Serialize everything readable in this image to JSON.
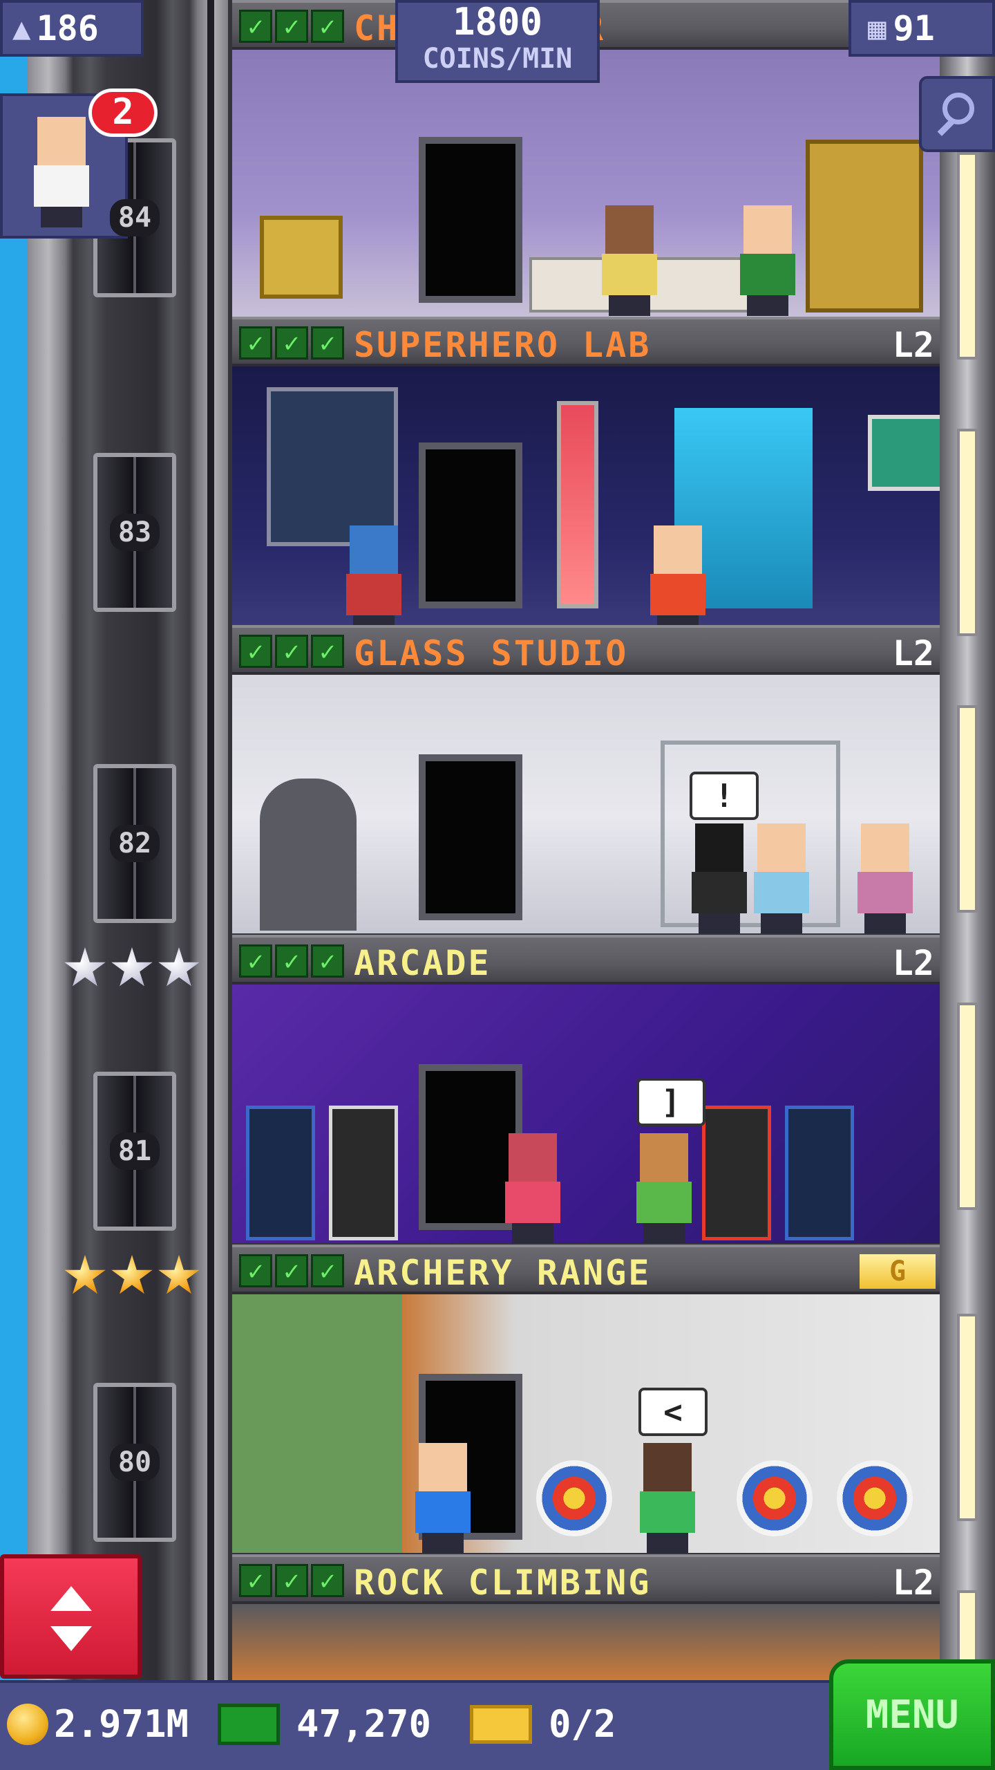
{
  "hud": {
    "population": "186",
    "coins_per_min_value": "1800",
    "coins_per_min_unit": "COINS/MIN",
    "floors_count": "91",
    "notifications": "2"
  },
  "shaft": {
    "floor_numbers": [
      "84",
      "83",
      "82",
      "81",
      "80"
    ]
  },
  "floors": [
    {
      "name": "CHOCOLATIER",
      "level": "",
      "checks": 3
    },
    {
      "name": "SUPERHERO LAB",
      "level": "L2",
      "checks": 3
    },
    {
      "name": "GLASS STUDIO",
      "level": "L2",
      "checks": 3
    },
    {
      "name": "ARCADE",
      "level": "L2",
      "checks": 3
    },
    {
      "name": "ARCHERY RANGE",
      "level": "",
      "badge": "G",
      "checks": 3
    },
    {
      "name": "ROCK CLIMBING",
      "level": "L2",
      "checks": 3
    }
  ],
  "bubbles": {
    "glass": "!",
    "arcade": "]",
    "archery": "<"
  },
  "bottom": {
    "coins": "2.971M",
    "bux": "47,270",
    "tickets": "0/2",
    "menu_label": "MENU"
  },
  "colors": {
    "hud_blue": "#4a4f8a",
    "menu_green": "#18a824",
    "elevator_red": "#d01a34",
    "name_orange": "#ff8a3a",
    "name_yellow": "#f8f08a"
  }
}
